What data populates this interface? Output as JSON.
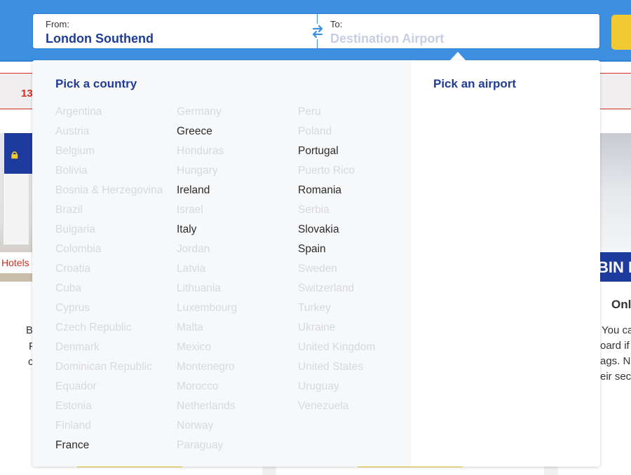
{
  "search": {
    "from_label": "From:",
    "from_value": "London Southend",
    "to_label": "To:",
    "to_placeholder": "Destination Airport",
    "swap_icon": "swap-arrows-icon"
  },
  "background": {
    "promo_text": "13",
    "hotels_text": "Hotels",
    "left_text_lines": [
      "B",
      "F",
      "c"
    ],
    "right_banner_text": "BIN B",
    "right_heading": "Onl",
    "right_text_lines": [
      "You ca",
      "oard if",
      "ags. N",
      "eir sec"
    ]
  },
  "dropdown": {
    "country_title": "Pick a country",
    "airport_title": "Pick an airport",
    "columns": [
      [
        {
          "name": "Argentina",
          "available": false
        },
        {
          "name": "Austria",
          "available": false
        },
        {
          "name": "Belgium",
          "available": false
        },
        {
          "name": "Bolivia",
          "available": false
        },
        {
          "name": "Bosnia & Herzegovina",
          "available": false
        },
        {
          "name": "Brazil",
          "available": false
        },
        {
          "name": "Bulgaria",
          "available": false
        },
        {
          "name": "Colombia",
          "available": false
        },
        {
          "name": "Croatia",
          "available": false
        },
        {
          "name": "Cuba",
          "available": false
        },
        {
          "name": "Cyprus",
          "available": false
        },
        {
          "name": "Czech Republic",
          "available": false
        },
        {
          "name": "Denmark",
          "available": false
        },
        {
          "name": "Dominican Republic",
          "available": false
        },
        {
          "name": "Equador",
          "available": false
        },
        {
          "name": "Estonia",
          "available": false
        },
        {
          "name": "Finland",
          "available": false
        },
        {
          "name": "France",
          "available": true
        }
      ],
      [
        {
          "name": "Germany",
          "available": false
        },
        {
          "name": "Greece",
          "available": true
        },
        {
          "name": "Honduras",
          "available": false
        },
        {
          "name": "Hungary",
          "available": false
        },
        {
          "name": "Ireland",
          "available": true
        },
        {
          "name": "Israel",
          "available": false
        },
        {
          "name": "Italy",
          "available": true
        },
        {
          "name": "Jordan",
          "available": false
        },
        {
          "name": "Latvia",
          "available": false
        },
        {
          "name": "Lithuania",
          "available": false
        },
        {
          "name": "Luxembourg",
          "available": false
        },
        {
          "name": "Malta",
          "available": false
        },
        {
          "name": "Mexico",
          "available": false
        },
        {
          "name": "Montenegro",
          "available": false
        },
        {
          "name": "Morocco",
          "available": false
        },
        {
          "name": "Netherlands",
          "available": false
        },
        {
          "name": "Norway",
          "available": false
        },
        {
          "name": "Paraguay",
          "available": false
        }
      ],
      [
        {
          "name": "Peru",
          "available": false
        },
        {
          "name": "Poland",
          "available": false
        },
        {
          "name": "Portugal",
          "available": true
        },
        {
          "name": "Puerto Rico",
          "available": false
        },
        {
          "name": "Romania",
          "available": true
        },
        {
          "name": "Serbia",
          "available": false
        },
        {
          "name": "Slovakia",
          "available": true
        },
        {
          "name": "Spain",
          "available": true
        },
        {
          "name": "Sweden",
          "available": false
        },
        {
          "name": "Switzerland",
          "available": false
        },
        {
          "name": "Turkey",
          "available": false
        },
        {
          "name": "Ukraine",
          "available": false
        },
        {
          "name": "United Kingdom",
          "available": false
        },
        {
          "name": "United States",
          "available": false
        },
        {
          "name": "Uruguay",
          "available": false
        },
        {
          "name": "Venezuela",
          "available": false
        }
      ]
    ]
  },
  "colors": {
    "header_blue": "#3d8fe1",
    "brand_navy": "#1f3c99",
    "accent_yellow": "#f1c932",
    "promo_red": "#d52d21",
    "available_text": "#2b2b2b",
    "unavailable_text": "#d7d9dd"
  }
}
